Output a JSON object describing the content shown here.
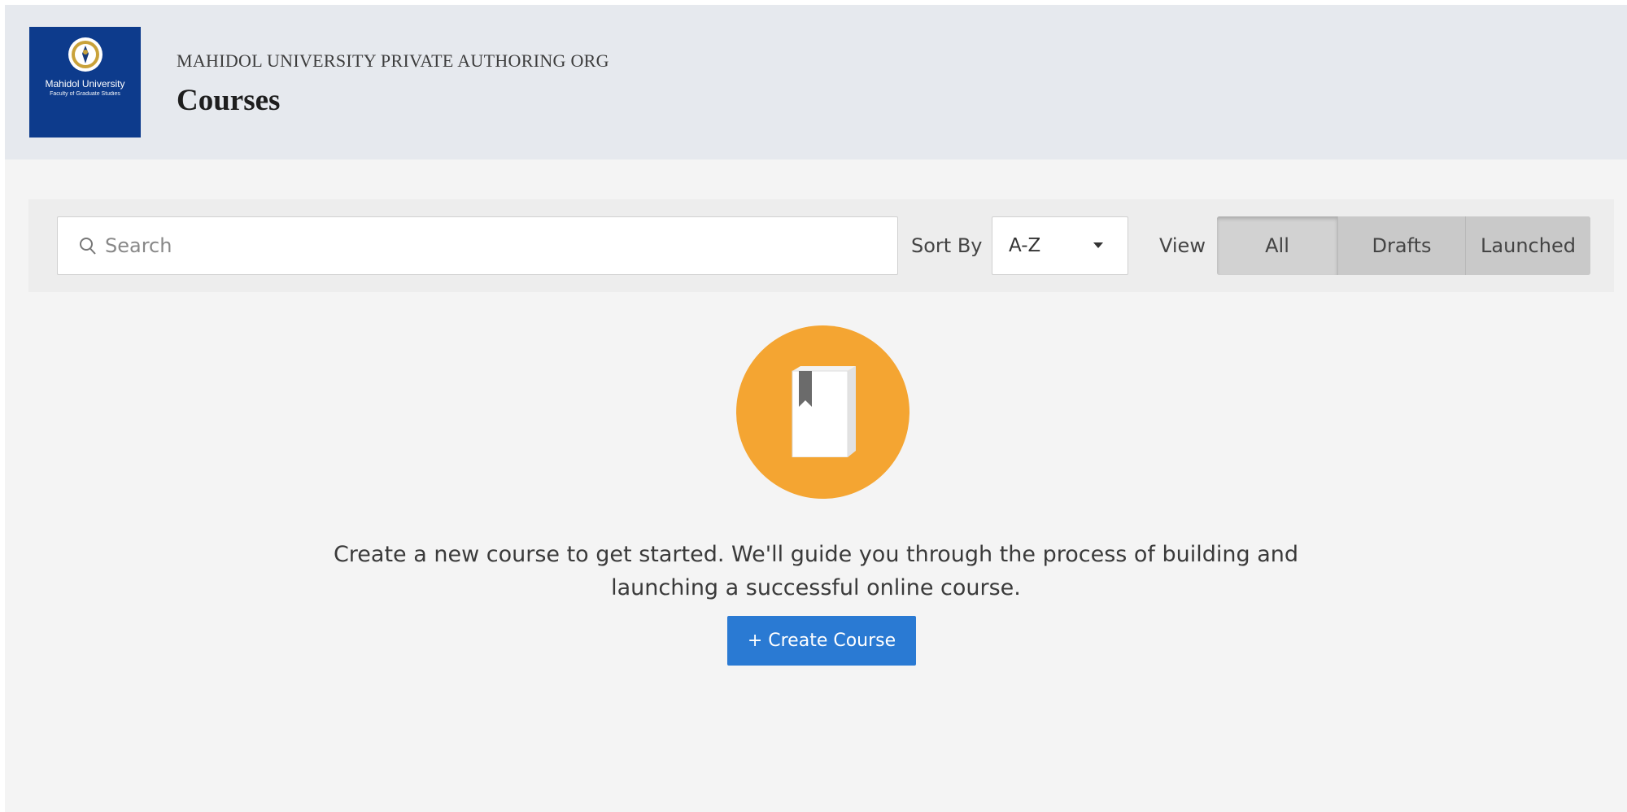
{
  "header": {
    "logo": {
      "name": "Mahidol University",
      "subtitle": "Faculty of Graduate Studies"
    },
    "org_name": "MAHIDOL UNIVERSITY PRIVATE AUTHORING ORG",
    "page_title": "Courses"
  },
  "toolbar": {
    "search": {
      "placeholder": "Search",
      "value": ""
    },
    "sort_label": "Sort By",
    "sort_value": "A-Z",
    "view_label": "View",
    "view_options": [
      "All",
      "Drafts",
      "Launched"
    ],
    "view_selected": "All"
  },
  "empty_state": {
    "message": "Create a new course to get started. We'll guide you through the process of building and launching a successful online course.",
    "button_label": "+ Create Course",
    "icon": "book-icon"
  },
  "colors": {
    "header_bg": "#e6e9ee",
    "logo_bg": "#0d3b8c",
    "accent_orange": "#f4a532",
    "primary_button": "#2a7ad3"
  }
}
